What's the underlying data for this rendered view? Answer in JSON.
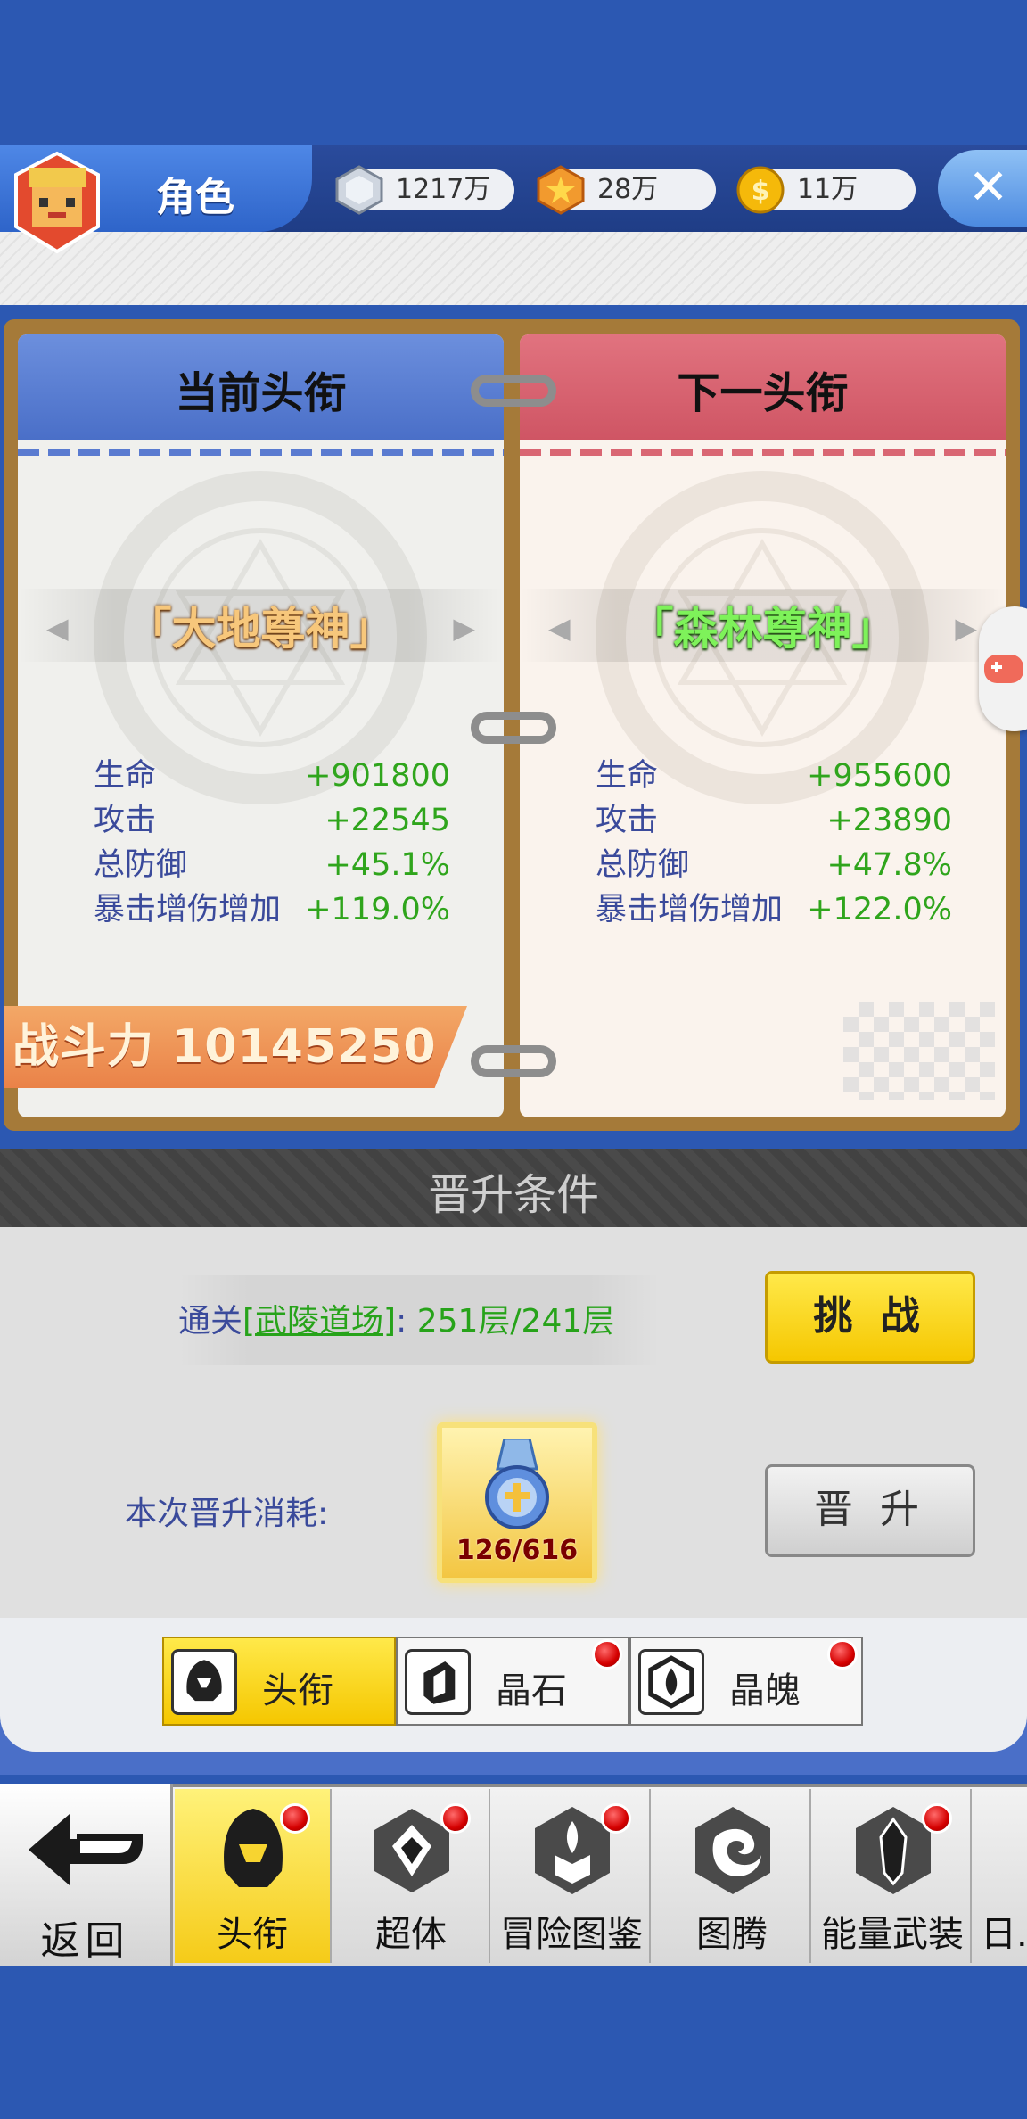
{
  "header": {
    "title": "角色",
    "currencies": [
      {
        "icon": "silver-coin-icon",
        "amount": "1217万"
      },
      {
        "icon": "star-medal-icon",
        "amount": "28万"
      },
      {
        "icon": "gold-coin-icon",
        "amount": "11万"
      }
    ]
  },
  "current": {
    "heading": "当前头衔",
    "name": "「大地尊神」",
    "stats": [
      {
        "label": "生命",
        "value": "+901800"
      },
      {
        "label": "攻击",
        "value": "+22545"
      },
      {
        "label": "总防御",
        "value": "+45.1%"
      },
      {
        "label": "暴击增伤增加",
        "value": "+119.0%"
      }
    ],
    "power": "战斗力 10145250"
  },
  "next": {
    "heading": "下一头衔",
    "name": "「森林尊神」",
    "stats": [
      {
        "label": "生命",
        "value": "+955600"
      },
      {
        "label": "攻击",
        "value": "+23890"
      },
      {
        "label": "总防御",
        "value": "+47.8%"
      },
      {
        "label": "暴击增伤增加",
        "value": "+122.0%"
      }
    ]
  },
  "conditions": {
    "title": "晋升条件",
    "requirement_prefix": "通关",
    "requirement_link": "[武陵道场]",
    "requirement_sep": ":",
    "requirement_value": "251层/241层",
    "challenge_label": "挑 战",
    "cost_label": "本次晋升消耗:",
    "cost_count": "126/616",
    "promote_label": "晋 升"
  },
  "subtabs": [
    {
      "label": "头衔",
      "active": true
    },
    {
      "label": "晶石",
      "active": false
    },
    {
      "label": "晶魄",
      "active": false
    }
  ],
  "nav": {
    "back": "返回",
    "items": [
      "头衔",
      "超体",
      "冒险图鉴",
      "图腾",
      "能量武装",
      "日..."
    ]
  },
  "colors": {
    "background": "#2c58b2",
    "current_header": "#5a7bd0",
    "next_header": "#d96673",
    "stat_value": "#2fa51c",
    "stat_label": "#3a4a9b",
    "button_yellow": "#f5c700"
  }
}
